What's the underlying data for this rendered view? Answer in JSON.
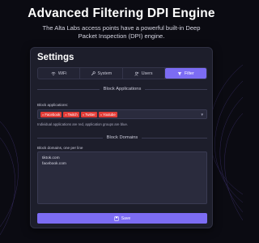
{
  "promo": {
    "headline": "Advanced Filtering  DPI Engine",
    "subtext_line1": "The Alta Labs access points have a powerful built-in Deep",
    "subtext_line2": "Packet Inspection (DPI) engine."
  },
  "settings": {
    "title": "Settings",
    "tabs": [
      {
        "label": "WiFi",
        "icon": "wifi-icon"
      },
      {
        "label": "System",
        "icon": "wrench-icon"
      },
      {
        "label": "Users",
        "icon": "users-icon"
      },
      {
        "label": "Filter",
        "icon": "filter-icon",
        "active": true
      }
    ],
    "block_applications": {
      "section_title": "Block Applications",
      "field_label": "Block applications:",
      "selected": [
        "Facebook",
        "Twitch",
        "Twitter",
        "Youtube"
      ],
      "help_text": "Individual applications are red, application groups are blue."
    },
    "block_domains": {
      "section_title": "Block Domains",
      "field_label": "Block domains, one per line",
      "domains": [
        "tiktok.com",
        "facebook.com"
      ]
    },
    "save_label": "Save"
  },
  "colors": {
    "accent": "#7c6cf3",
    "chip_red": "#e23b36",
    "panel_bg": "#1d1e2b",
    "page_bg": "#0b0b12"
  }
}
